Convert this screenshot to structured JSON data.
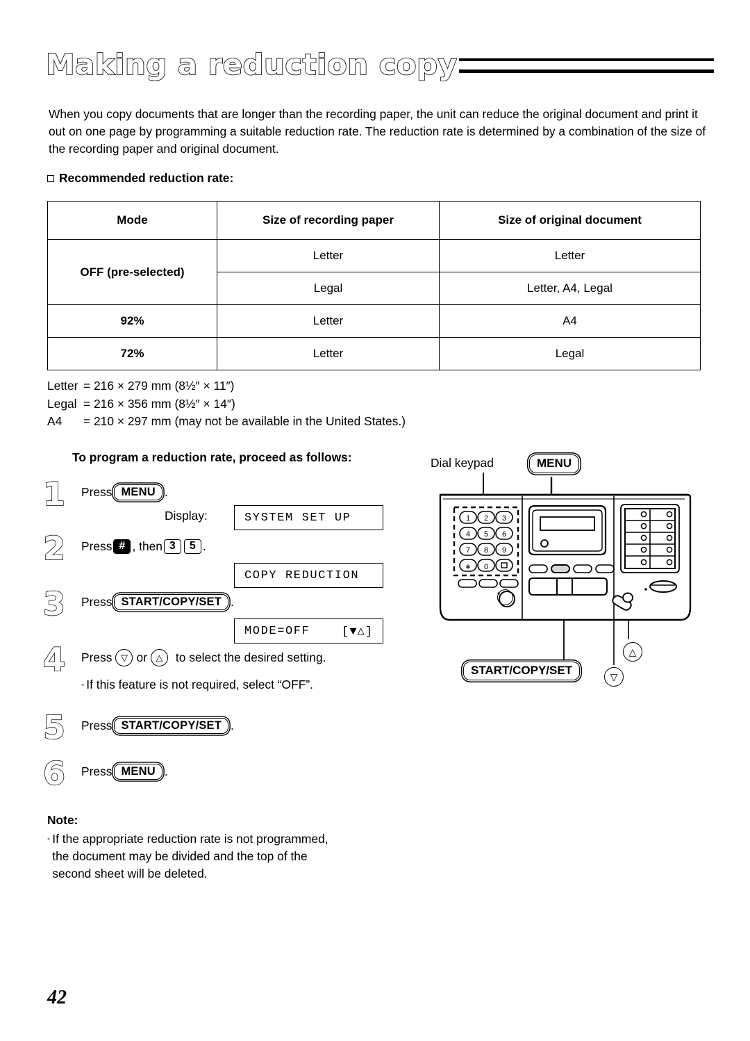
{
  "page": {
    "title": "Making a reduction copy",
    "number": "42"
  },
  "intro": {
    "paragraph": "When you copy documents that are longer than the recording paper, the unit can reduce the original document and print it out on one page by programming a suitable reduction rate. The reduction rate is determined by a combination of the size of the recording paper and original document."
  },
  "recommended": {
    "heading": "Recommended reduction rate:",
    "table": {
      "headers": [
        "Mode",
        "Size of recording paper",
        "Size of original document"
      ],
      "rows": [
        {
          "mode": "OFF (pre-selected)",
          "paper": "Letter",
          "original": "Letter"
        },
        {
          "mode": "",
          "paper": "Legal",
          "original": "Letter, A4, Legal"
        },
        {
          "mode": "92%",
          "paper": "Letter",
          "original": "A4"
        },
        {
          "mode": "72%",
          "paper": "Letter",
          "original": "Legal"
        }
      ]
    }
  },
  "size_legend": [
    {
      "label": "Letter",
      "eq": "=",
      "metric": "216 × 279 mm",
      "imperial": "(8½″ × 11″)"
    },
    {
      "label": "Legal",
      "eq": "=",
      "metric": "216 × 356 mm",
      "imperial": "(8½″ × 14″)"
    },
    {
      "label": "A4",
      "eq": "=",
      "metric": "210 × 297 mm",
      "imperial": "(may not be available in the United States.)"
    }
  ],
  "procedure": {
    "heading": "To program a reduction rate, proceed as follows:",
    "display_label": "Display:",
    "steps": {
      "s1": {
        "num": "1",
        "press": "Press",
        "key": "MENU",
        "period": "."
      },
      "s2": {
        "num": "2",
        "press": "Press",
        "key_hash": "#",
        "then": ", then",
        "key_3": "3",
        "key_5": "5",
        "period": "."
      },
      "s3": {
        "num": "3",
        "press": "Press",
        "key": "START/COPY/SET",
        "period": "."
      },
      "s4": {
        "num": "4",
        "press": "Press",
        "key_down": "▽",
        "or": "or",
        "key_up": "△",
        "tail": "to select the desired setting.",
        "note": "If this feature is not required, select “OFF”."
      },
      "s5": {
        "num": "5",
        "press": "Press",
        "key": "START/COPY/SET",
        "period": "."
      },
      "s6": {
        "num": "6",
        "press": "Press",
        "key": "MENU",
        "period": "."
      }
    },
    "displays": {
      "d1": {
        "text": "SYSTEM SET UP",
        "right": ""
      },
      "d2": {
        "text": "COPY REDUCTION",
        "right": ""
      },
      "d3": {
        "text": "MODE=OFF",
        "right": "[▼△]"
      }
    }
  },
  "figure": {
    "dial_keypad_label": "Dial keypad",
    "menu_label": "MENU",
    "start_copy_set_label": "START/COPY/SET",
    "up_arrow": "△",
    "down_arrow": "▽",
    "keypad_keys": [
      "1",
      "2",
      "3",
      "4",
      "5",
      "6",
      "7",
      "8",
      "9",
      "∗",
      "0",
      "□"
    ]
  },
  "note": {
    "title": "Note:",
    "lines": [
      "If the appropriate reduction rate is not programmed,",
      "the document may be divided and the top of the",
      "second sheet will be deleted."
    ]
  }
}
